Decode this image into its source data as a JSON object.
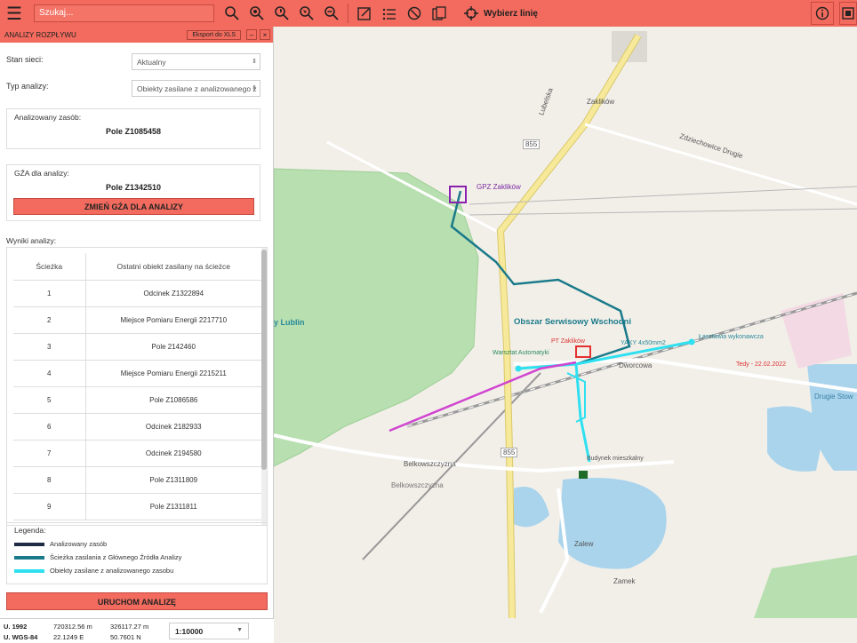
{
  "toolbar": {
    "search_placeholder": "Szukaj...",
    "select_line_label": "Wybierz linię"
  },
  "panel": {
    "title": "ANALIZY ROZPŁYWU",
    "export_label": "Eksport do XLS",
    "minimize_label": "–",
    "close_label": "×",
    "network_state_label": "Stan sieci:",
    "network_state_value": "Aktualny",
    "analysis_type_label": "Typ analizy:",
    "analysis_type_value": "Obiekty zasilane z analizowanego z",
    "analyzed_asset_label": "Analizowany zasób:",
    "analyzed_asset_value": "Pole Z1085458",
    "gza_label": "GŹA dla analizy:",
    "gza_value": "Pole Z1342510",
    "change_gza_button": "ZMIEŃ GŹA DLA ANALIZY",
    "results_label": "Wyniki analizy:",
    "results_headers": [
      "Ścieżka",
      "Ostatni obiekt zasilany na ścieżce"
    ],
    "results_rows": [
      [
        "1",
        "Odcinek Z1322894"
      ],
      [
        "2",
        "Miejsce Pomiaru Energii 2217710"
      ],
      [
        "3",
        "Pole 2142460"
      ],
      [
        "4",
        "Miejsce Pomiaru Energii 2215211"
      ],
      [
        "5",
        "Pole Z1086586"
      ],
      [
        "6",
        "Odcinek 2182933"
      ],
      [
        "7",
        "Odcinek 2194580"
      ],
      [
        "8",
        "Pole Z1311809"
      ],
      [
        "9",
        "Pole Z1311811"
      ]
    ],
    "legend_title": "Legenda:",
    "legend_items": [
      {
        "label": "Analizowany zasób",
        "color": "#1f2a44"
      },
      {
        "label": "Ścieżka zasilania z Głównego Źródła Analizy",
        "color": "#1a7a8a"
      },
      {
        "label": "Obiekty zasilane z analizowanego zasobu",
        "color": "#2fe0f0"
      }
    ],
    "run_button": "URUCHOM ANALIZĘ"
  },
  "status": {
    "u1992_label": "U. 1992",
    "u1992_x": "720312.56 m",
    "u1992_y": "326117.27 m",
    "wgs_label": "U. WGS-84",
    "wgs_lon": "22.1249 E",
    "wgs_lat": "50.7601 N",
    "scale": "1:10000"
  },
  "map": {
    "labels": {
      "gpz": "GPZ Zaklików",
      "service_area": "Obszar Serwisowy Wschodni",
      "lublin": "y Lublin",
      "road_855a": "855",
      "road_855b": "855",
      "lubelska": "Lubelska",
      "zaklikow": "Zaklików",
      "zdziechowice": "Zdziechowice Drugie",
      "belkowszczyzna": "Belkowszczyzna",
      "belkowszczyzna_st": "Belkowszczyzna",
      "dworcowa": "Dworcowa",
      "zalew": "Zalew",
      "zamek": "Zamek",
      "drugie": "Drugie Stow",
      "budynek": "Budynek mieszkalny",
      "warsztat": "Warsztat Automatyki",
      "pt_zaklikow": "PT Zaklików",
      "teddy": "Tedy - 22.02.2022",
      "przedsiebiorstwo": "Łasztawia wykonawcza",
      "yaky": "YAKY 4x50mm2",
      "zakliow_road": "Zaklików"
    }
  }
}
